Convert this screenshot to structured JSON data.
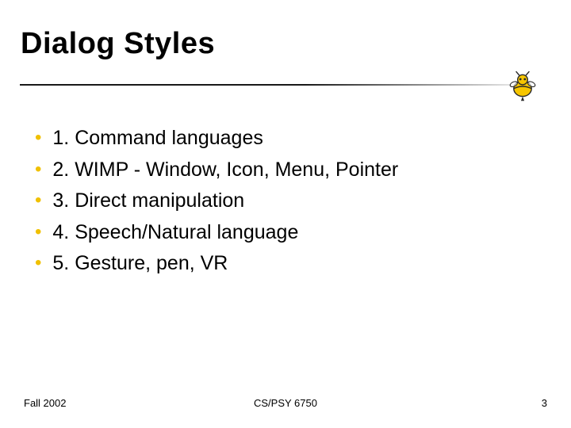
{
  "title": "Dialog Styles",
  "items": [
    "1. Command languages",
    "2. WIMP - Window, Icon, Menu, Pointer",
    "3. Direct manipulation",
    "4. Speech/Natural language",
    "5. Gesture, pen, VR"
  ],
  "footer": {
    "left": "Fall 2002",
    "center": "CS/PSY 6750",
    "right": "3"
  },
  "colors": {
    "bullet": "#f0c000",
    "mascot_body": "#f7c600",
    "mascot_outline": "#2a2a2a"
  }
}
